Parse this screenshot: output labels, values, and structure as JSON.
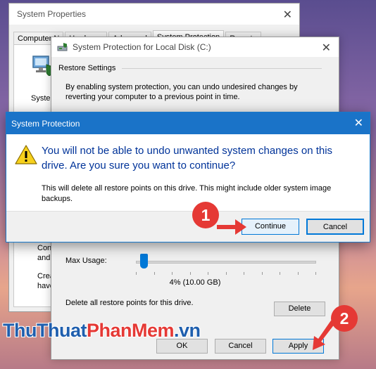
{
  "system_properties": {
    "title": "System Properties",
    "tabs": [
      "Computer N",
      "Hardware",
      "Advanced",
      "System Protection",
      "Remote"
    ],
    "active_tab": "System Protection",
    "body_fragment": "System",
    "fragment_lines_1": [
      "Config",
      "and d"
    ],
    "fragment_lines_2": [
      "Creat",
      "have"
    ]
  },
  "local_disk": {
    "title": "System Protection for Local Disk (C:)",
    "restore_settings_heading": "Restore Settings",
    "restore_description": "By enabling system protection, you can undo undesired changes by reverting your computer to a previous point in time.",
    "max_usage_label": "Max Usage:",
    "max_usage_percent": 4,
    "max_usage_value": "4% (10.00 GB)",
    "delete_description": "Delete all restore points for this drive.",
    "delete_button": "Delete",
    "ok_button": "OK",
    "cancel_button": "Cancel",
    "apply_button": "Apply"
  },
  "confirm_dialog": {
    "title": "System Protection",
    "main_instruction": "You will not be able to undo unwanted system changes on this drive. Are you sure you want to continue?",
    "content": "This will delete all restore points on this drive. This might include older system image backups.",
    "continue_button": "Continue",
    "cancel_button": "Cancel"
  },
  "annotations": {
    "step1": "1",
    "step2": "2"
  },
  "watermark": {
    "part1": "ThuThuat",
    "part2": "PhanMem",
    "part3": ".vn"
  },
  "colors": {
    "titlebar_blue": "#1a73c8",
    "instruction_blue": "#003399",
    "step_red": "#e53935",
    "accent": "#0078d7"
  }
}
